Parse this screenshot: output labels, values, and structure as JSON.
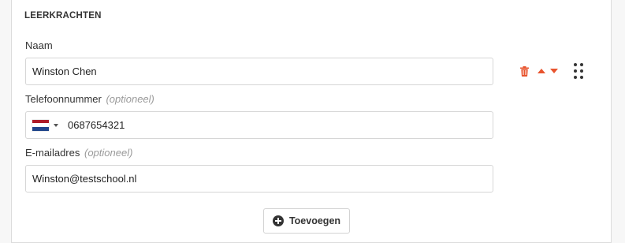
{
  "section": {
    "title": "LEERKRACHTEN"
  },
  "teacher": {
    "name": {
      "label": "Naam",
      "value": "Winston Chen"
    },
    "phone": {
      "label": "Telefoonnummer",
      "optional": "(optioneel)",
      "country_flag": "netherlands-flag",
      "value": "0687654321"
    },
    "email": {
      "label": "E-mailadres",
      "optional": "(optioneel)",
      "value": "Winston@testschool.nl"
    },
    "actions": {
      "delete_icon": "trash-icon",
      "move_up_icon": "arrow-up-icon",
      "move_down_icon": "arrow-down-icon",
      "drag_icon": "drag-handle-icon"
    }
  },
  "add_button": {
    "label": "Toevoegen",
    "icon": "plus-circle-icon"
  },
  "colors": {
    "accent": "#e8542e",
    "text": "#333333",
    "border": "#d6d6d6",
    "flag_red": "#ae1c28",
    "flag_white": "#ffffff",
    "flag_blue": "#21468b"
  }
}
